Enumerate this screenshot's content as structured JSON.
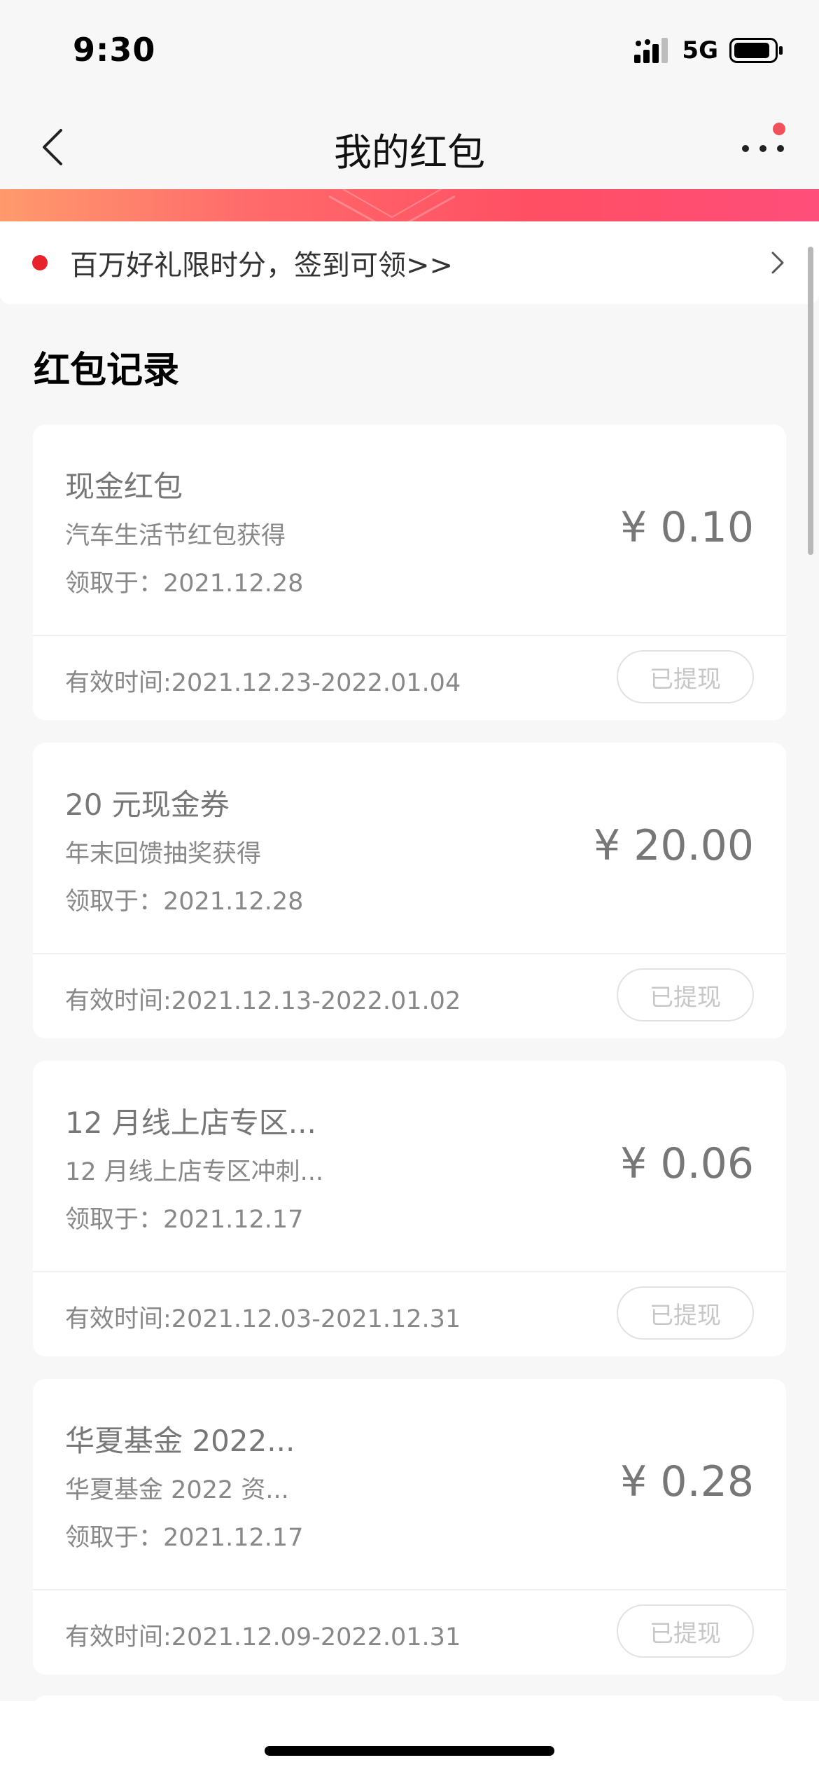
{
  "status_bar": {
    "time": "9:30",
    "network": "5G",
    "icons": [
      "signal-icon",
      "battery-icon"
    ]
  },
  "nav": {
    "title": "我的红包",
    "back_icon": "chevron-left-icon",
    "more_icon": "more-dots-icon",
    "more_badge_color": "#f0515b"
  },
  "promo": {
    "text": "百万好礼限时分，签到可领>>",
    "dot_color": "#e8222b",
    "arrow_icon": "chevron-right-icon"
  },
  "section": {
    "title": "红包记录"
  },
  "colors": {
    "gradient_start": "#ff9a6c",
    "gradient_end": "#ff4e7a",
    "background": "#f7f7f7"
  },
  "records": [
    {
      "name": "现金红包",
      "source": "汽车生活节红包获得",
      "received": "领取于：2021.12.28",
      "amount": "¥ 0.10",
      "validity": "有效时间:2021.12.23-2022.01.04",
      "button": "已提现"
    },
    {
      "name": "20 元现金券",
      "source": "年末回馈抽奖获得",
      "received": "领取于：2021.12.28",
      "amount": "¥ 20.00",
      "validity": "有效时间:2021.12.13-2022.01.02",
      "button": "已提现"
    },
    {
      "name": "12 月线上店专区...",
      "source": "12 月线上店专区冲刺...",
      "received": "领取于：2021.12.17",
      "amount": "¥ 0.06",
      "validity": "有效时间:2021.12.03-2021.12.31",
      "button": "已提现"
    },
    {
      "name": "华夏基金 2022...",
      "source": "华夏基金 2022 资...",
      "received": "领取于：2021.12.17",
      "amount": "¥ 0.28",
      "validity": "有效时间:2021.12.09-2022.01.31",
      "button": "已提现"
    }
  ]
}
